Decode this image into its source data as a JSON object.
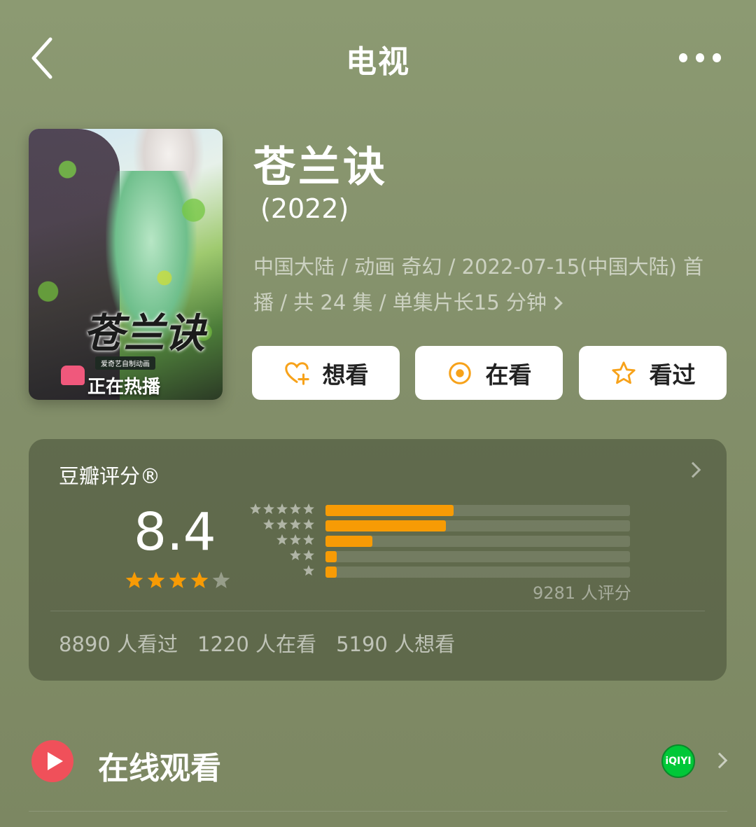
{
  "nav": {
    "title": "电视",
    "back_icon": "chevron-left-icon",
    "more_icon": "more-dots-icon"
  },
  "poster": {
    "title": "苍兰诀",
    "subtitle": "爱奇艺自制动画",
    "status": "正在热播",
    "image_description": "anime poster artwork"
  },
  "info": {
    "title": "苍兰诀",
    "year": "(2022)",
    "meta_line1": "中国大陆 / 动画 奇幻 / 2022-07-15(中国大陆) 首",
    "meta_line2": "播 / 共 24 集 / 单集片长15 分钟"
  },
  "actions": [
    {
      "label": "想看",
      "icon": "heart-plus-icon",
      "color": "#f7a21a"
    },
    {
      "label": "在看",
      "icon": "target-icon",
      "color": "#f7a21a"
    },
    {
      "label": "看过",
      "icon": "star-outline-icon",
      "color": "#f7a21a"
    }
  ],
  "rating": {
    "label": "豆瓣评分®",
    "score": "8.4",
    "stars": 4,
    "distribution": [
      {
        "stars": 5,
        "fraction": 0.42
      },
      {
        "stars": 4,
        "fraction": 0.395
      },
      {
        "stars": 3,
        "fraction": 0.155
      },
      {
        "stars": 2,
        "fraction": 0.037
      },
      {
        "stars": 1,
        "fraction": 0.037
      }
    ],
    "raters": "9281 人评分",
    "watched": "8890 人看过",
    "watching": "1220 人在看",
    "wish": "5190 人想看"
  },
  "watch": {
    "label": "在线观看",
    "provider": "iQIYI",
    "play_icon": "play-icon",
    "provider_icon": "iqiyi-logo-icon"
  },
  "colors": {
    "accent": "#f79b05",
    "play": "#f0505a",
    "provider": "#00c838"
  }
}
